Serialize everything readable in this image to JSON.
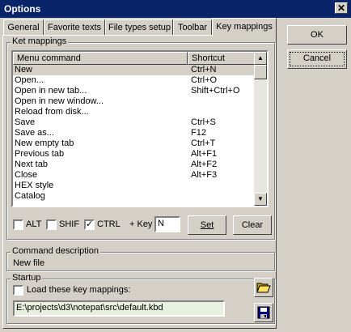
{
  "window": {
    "title": "Options",
    "close_glyph": "✕"
  },
  "tabs": [
    {
      "label": "General"
    },
    {
      "label": "Favorite texts"
    },
    {
      "label": "File types setup"
    },
    {
      "label": "Toolbar"
    },
    {
      "label": "Key mappings"
    }
  ],
  "buttons": {
    "ok": "OK",
    "cancel": "Cancel",
    "set": "Set",
    "clear": "Clear"
  },
  "mappings": {
    "group_label": "Ket mappings",
    "headers": {
      "command": "Menu command",
      "shortcut": "Shortcut"
    },
    "rows": [
      {
        "command": "New",
        "shortcut": "Ctrl+N"
      },
      {
        "command": "Open...",
        "shortcut": "Ctrl+O"
      },
      {
        "command": "Open in new tab...",
        "shortcut": "Shift+Ctrl+O"
      },
      {
        "command": "Open in new window...",
        "shortcut": ""
      },
      {
        "command": "Reload from disk...",
        "shortcut": ""
      },
      {
        "command": "Save",
        "shortcut": "Ctrl+S"
      },
      {
        "command": "Save as...",
        "shortcut": "F12"
      },
      {
        "command": "New empty tab",
        "shortcut": "Ctrl+T"
      },
      {
        "command": "Previous tab",
        "shortcut": "Alt+F1"
      },
      {
        "command": "Next tab",
        "shortcut": "Alt+F2"
      },
      {
        "command": "Close",
        "shortcut": "Alt+F3"
      },
      {
        "command": "HEX style",
        "shortcut": ""
      },
      {
        "command": "Catalog",
        "shortcut": ""
      }
    ],
    "modifiers": {
      "alt": {
        "label": "ALT",
        "checked": ""
      },
      "shift": {
        "label": "SHIF",
        "checked": ""
      },
      "ctrl": {
        "label": "CTRL",
        "checked": "✓"
      }
    },
    "key_label": "+ Key",
    "key_value": "N"
  },
  "description": {
    "group_label": "Command description",
    "text": "New file"
  },
  "startup": {
    "group_label": "Startup",
    "load_label": "Load these key mappings:",
    "load_checked": "",
    "path": "E:\\projects\\d3\\notepat\\src\\default.kbd"
  },
  "icons": {
    "scroll_up": "▲",
    "scroll_down": "▼",
    "open_folder": "folder-open-icon",
    "save": "floppy-disk-icon"
  },
  "colors": {
    "title_bar": "#0a246a",
    "dialog_bg": "#d4d0c8",
    "path_field_bg": "#e8f0e0"
  }
}
